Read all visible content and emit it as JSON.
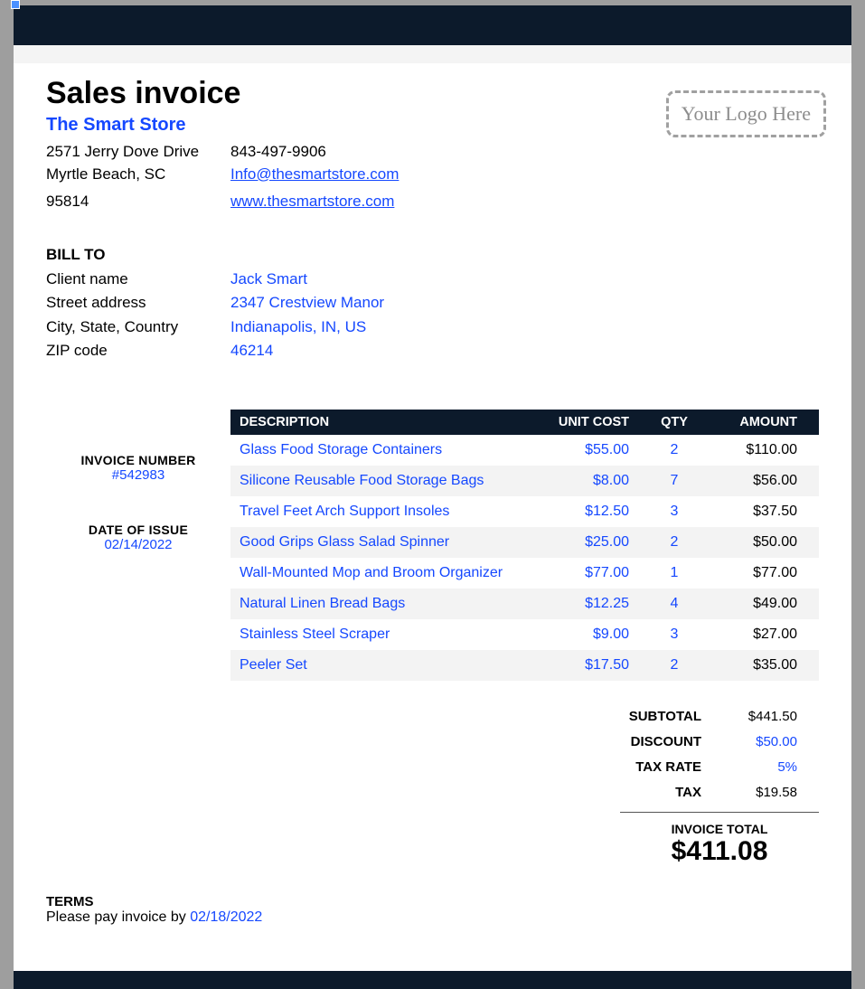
{
  "title": "Sales invoice",
  "company": {
    "name": "The Smart Store",
    "address_line1": "2571 Jerry Dove Drive",
    "address_line2": "Myrtle Beach, SC",
    "zip": "95814",
    "phone": "843-497-9906",
    "email": "Info@thesmartstore.com",
    "website": "www.thesmartstore.com"
  },
  "logo_placeholder": "Your Logo Here",
  "bill_to": {
    "heading": "BILL TO",
    "labels": {
      "client": "Client name",
      "street": "Street address",
      "city": "City, State, Country",
      "zip": "ZIP code"
    },
    "values": {
      "client": "Jack Smart",
      "street": "2347 Crestview Manor",
      "city": "Indianapolis, IN, US",
      "zip": "46214"
    }
  },
  "meta": {
    "invoice_number_label": "INVOICE NUMBER",
    "invoice_number": "#542983",
    "date_label": "DATE OF ISSUE",
    "date": "02/14/2022"
  },
  "table": {
    "headers": {
      "desc": "DESCRIPTION",
      "cost": "UNIT COST",
      "qty": "QTY",
      "amt": "AMOUNT"
    },
    "rows": [
      {
        "desc": "Glass Food Storage Containers",
        "cost": "$55.00",
        "qty": "2",
        "amt": "$110.00"
      },
      {
        "desc": "Silicone Reusable Food Storage Bags",
        "cost": "$8.00",
        "qty": "7",
        "amt": "$56.00"
      },
      {
        "desc": "Travel Feet Arch Support Insoles",
        "cost": "$12.50",
        "qty": "3",
        "amt": "$37.50"
      },
      {
        "desc": "Good Grips Glass Salad Spinner",
        "cost": "$25.00",
        "qty": "2",
        "amt": "$50.00"
      },
      {
        "desc": "Wall-Mounted Mop and Broom Organizer",
        "cost": "$77.00",
        "qty": "1",
        "amt": "$77.00"
      },
      {
        "desc": "Natural Linen Bread Bags",
        "cost": "$12.25",
        "qty": "4",
        "amt": "$49.00"
      },
      {
        "desc": "Stainless Steel Scraper",
        "cost": "$9.00",
        "qty": "3",
        "amt": "$27.00"
      },
      {
        "desc": "Peeler Set",
        "cost": "$17.50",
        "qty": "2",
        "amt": "$35.00"
      }
    ]
  },
  "totals": {
    "subtotal_label": "SUBTOTAL",
    "subtotal": "$441.50",
    "discount_label": "DISCOUNT",
    "discount": "$50.00",
    "taxrate_label": "TAX RATE",
    "taxrate": "5%",
    "tax_label": "TAX",
    "tax": "$19.58",
    "total_label": "INVOICE TOTAL",
    "total": "$411.08"
  },
  "terms": {
    "heading": "TERMS",
    "prefix": "Please pay invoice by ",
    "date": "02/18/2022"
  }
}
